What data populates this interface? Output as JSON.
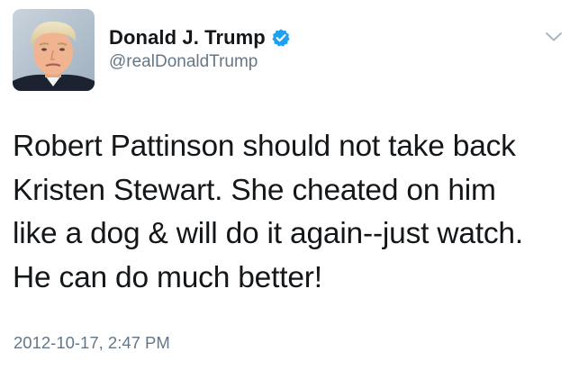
{
  "tweet": {
    "author": {
      "display_name": "Donald J. Trump",
      "handle": "@realDonaldTrump",
      "verified": true,
      "avatar_icon": "profile-photo"
    },
    "menu_icon": "chevron-down-icon",
    "text_lines": [
      "Robert Pattinson should not take back",
      "Kristen Stewart. She cheated on him",
      "like a dog & will do it again--just watch.",
      "He can do much better!"
    ],
    "timestamp": "2012-10-17, 2:47 PM"
  },
  "colors": {
    "text": "#14171a",
    "secondary_text": "#657786",
    "verified_blue": "#1da1f2",
    "background": "#ffffff"
  }
}
